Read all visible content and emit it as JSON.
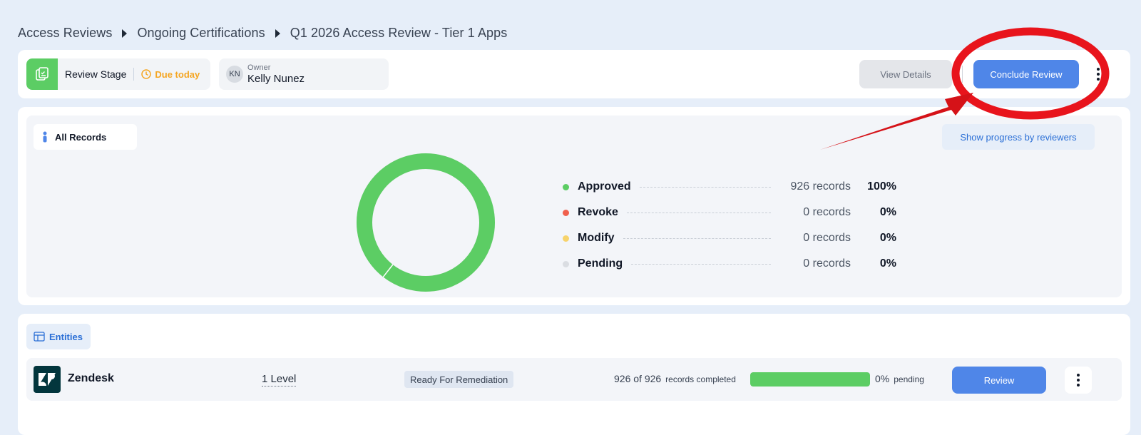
{
  "breadcrumb": {
    "items": [
      "Access Reviews",
      "Ongoing Certifications",
      "Q1 2026 Access Review - Tier 1 Apps"
    ]
  },
  "header": {
    "stage_label": "Review Stage",
    "due_label": "Due today",
    "owner_caption": "Owner",
    "owner_initials": "KN",
    "owner_name": "Kelly Nunez",
    "view_details_label": "View Details",
    "conclude_label": "Conclude Review"
  },
  "summary": {
    "filter_label": "All Records",
    "progress_button_label": "Show progress by reviewers",
    "legend": [
      {
        "label": "Approved",
        "count": "926 records",
        "pct": "100%",
        "color": "#5ccd64"
      },
      {
        "label": "Revoke",
        "count": "0 records",
        "pct": "0%",
        "color": "#f0604d"
      },
      {
        "label": "Modify",
        "count": "0 records",
        "pct": "0%",
        "color": "#f7d36b"
      },
      {
        "label": "Pending",
        "count": "0 records",
        "pct": "0%",
        "color": "#dadde2"
      }
    ]
  },
  "chart_data": {
    "type": "pie",
    "categories": [
      "Approved",
      "Revoke",
      "Modify",
      "Pending"
    ],
    "values": [
      926,
      0,
      0,
      0
    ],
    "colors": [
      "#5ccd64",
      "#f0604d",
      "#f7d36b",
      "#dadde2"
    ]
  },
  "entities": {
    "tab_label": "Entities",
    "rows": [
      {
        "name": "Zendesk",
        "level": "1 Level",
        "status": "Ready For Remediation",
        "completed": "926 of 926",
        "completed_suffix": "records completed",
        "progress": 1.0,
        "pending_pct": "0%",
        "pending_suffix": "pending",
        "review_label": "Review"
      }
    ]
  },
  "colors": {
    "accent": "#4f86e8",
    "success": "#5ccd64",
    "warning": "#f5a623",
    "annotation": "#e8141c"
  }
}
